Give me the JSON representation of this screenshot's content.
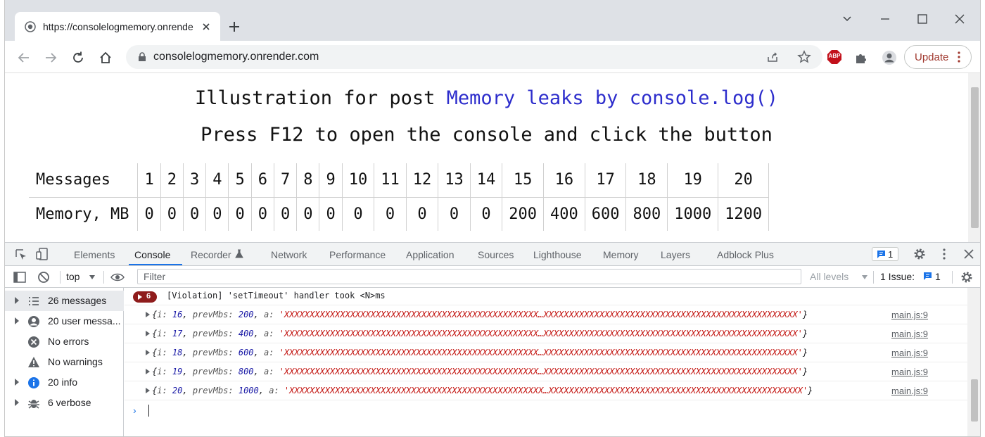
{
  "browser": {
    "tab_title": "https://consolelogmemory.onrender.com",
    "url": "consolelogmemory.onrender.com",
    "update_label": "Update",
    "abp_label": "ABP"
  },
  "page": {
    "heading_prefix": "Illustration for post ",
    "heading_link": "Memory leaks by console.log()",
    "subheading": "Press F12 to open the console and click the button",
    "table": {
      "row1_label": "Messages",
      "row2_label": "Memory, MB",
      "messages": [
        "1",
        "2",
        "3",
        "4",
        "5",
        "6",
        "7",
        "8",
        "9",
        "10",
        "11",
        "12",
        "13",
        "14",
        "15",
        "16",
        "17",
        "18",
        "19",
        "20"
      ],
      "memory": [
        "0",
        "0",
        "0",
        "0",
        "0",
        "0",
        "0",
        "0",
        "0",
        "0",
        "0",
        "0",
        "0",
        "0",
        "200",
        "400",
        "600",
        "800",
        "1000",
        "1200"
      ]
    }
  },
  "devtools": {
    "tabs": [
      "Elements",
      "Console",
      "Recorder",
      "Network",
      "Performance",
      "Application",
      "Sources",
      "Lighthouse",
      "Memory",
      "Layers",
      "Adblock Plus"
    ],
    "issues_badge_count": "1",
    "context": "top",
    "filter_placeholder": "Filter",
    "levels": "All levels",
    "issue_label": "1 Issue:",
    "issue_count": "1",
    "sidebar": [
      {
        "label": "26 messages",
        "icon": "list-icon"
      },
      {
        "label": "20 user messa...",
        "icon": "user-icon"
      },
      {
        "label": "No errors",
        "icon": "error-icon"
      },
      {
        "label": "No warnings",
        "icon": "warning-icon"
      },
      {
        "label": "20 info",
        "icon": "info-icon"
      },
      {
        "label": "6 verbose",
        "icon": "bug-icon"
      }
    ],
    "violation": {
      "count": "6",
      "text": "[Violation] 'setTimeout' handler took <N>ms"
    },
    "logs": [
      {
        "i": "16",
        "prevMbs": "200",
        "a": "'XXXXXXXXXXXXXXXXXXXXXXXXXXXXXXXXXXXXXXXXXXXXXXXXXX…XXXXXXXXXXXXXXXXXXXXXXXXXXXXXXXXXXXXXXXXXXXXXXXXXX'",
        "src": "main.js:9"
      },
      {
        "i": "17",
        "prevMbs": "400",
        "a": "'XXXXXXXXXXXXXXXXXXXXXXXXXXXXXXXXXXXXXXXXXXXXXXXXXX…XXXXXXXXXXXXXXXXXXXXXXXXXXXXXXXXXXXXXXXXXXXXXXXXXX'",
        "src": "main.js:9"
      },
      {
        "i": "18",
        "prevMbs": "600",
        "a": "'XXXXXXXXXXXXXXXXXXXXXXXXXXXXXXXXXXXXXXXXXXXXXXXXXX…XXXXXXXXXXXXXXXXXXXXXXXXXXXXXXXXXXXXXXXXXXXXXXXXXX'",
        "src": "main.js:9"
      },
      {
        "i": "19",
        "prevMbs": "800",
        "a": "'XXXXXXXXXXXXXXXXXXXXXXXXXXXXXXXXXXXXXXXXXXXXXXXXXX…XXXXXXXXXXXXXXXXXXXXXXXXXXXXXXXXXXXXXXXXXXXXXXXXXX'",
        "src": "main.js:9"
      },
      {
        "i": "20",
        "prevMbs": "1000",
        "a": "'XXXXXXXXXXXXXXXXXXXXXXXXXXXXXXXXXXXXXXXXXXXXXXXXXX…XXXXXXXXXXXXXXXXXXXXXXXXXXXXXXXXXXXXXXXXXXXXXXXXXX'",
        "src": "main.js:9"
      }
    ]
  },
  "colors": {
    "accent": "#1a73e8",
    "link": "#2d2dcc",
    "violation": "#8f1c1c",
    "update": "#a0382e"
  }
}
